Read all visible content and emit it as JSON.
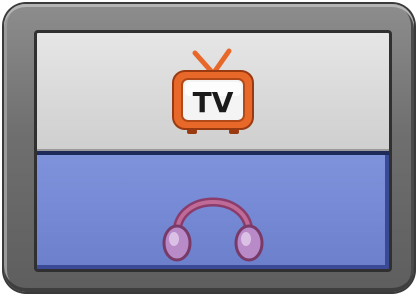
{
  "options": {
    "tv": {
      "label": "TV",
      "icon": "tv-icon"
    },
    "audio": {
      "icon": "headphones-icon"
    }
  },
  "colors": {
    "frame": "#7a7a7a",
    "tv_panel": "#d8d8d8",
    "audio_panel": "#7488d4",
    "tv_icon_orange": "#e8682a",
    "headphones": "#a04a7a"
  }
}
